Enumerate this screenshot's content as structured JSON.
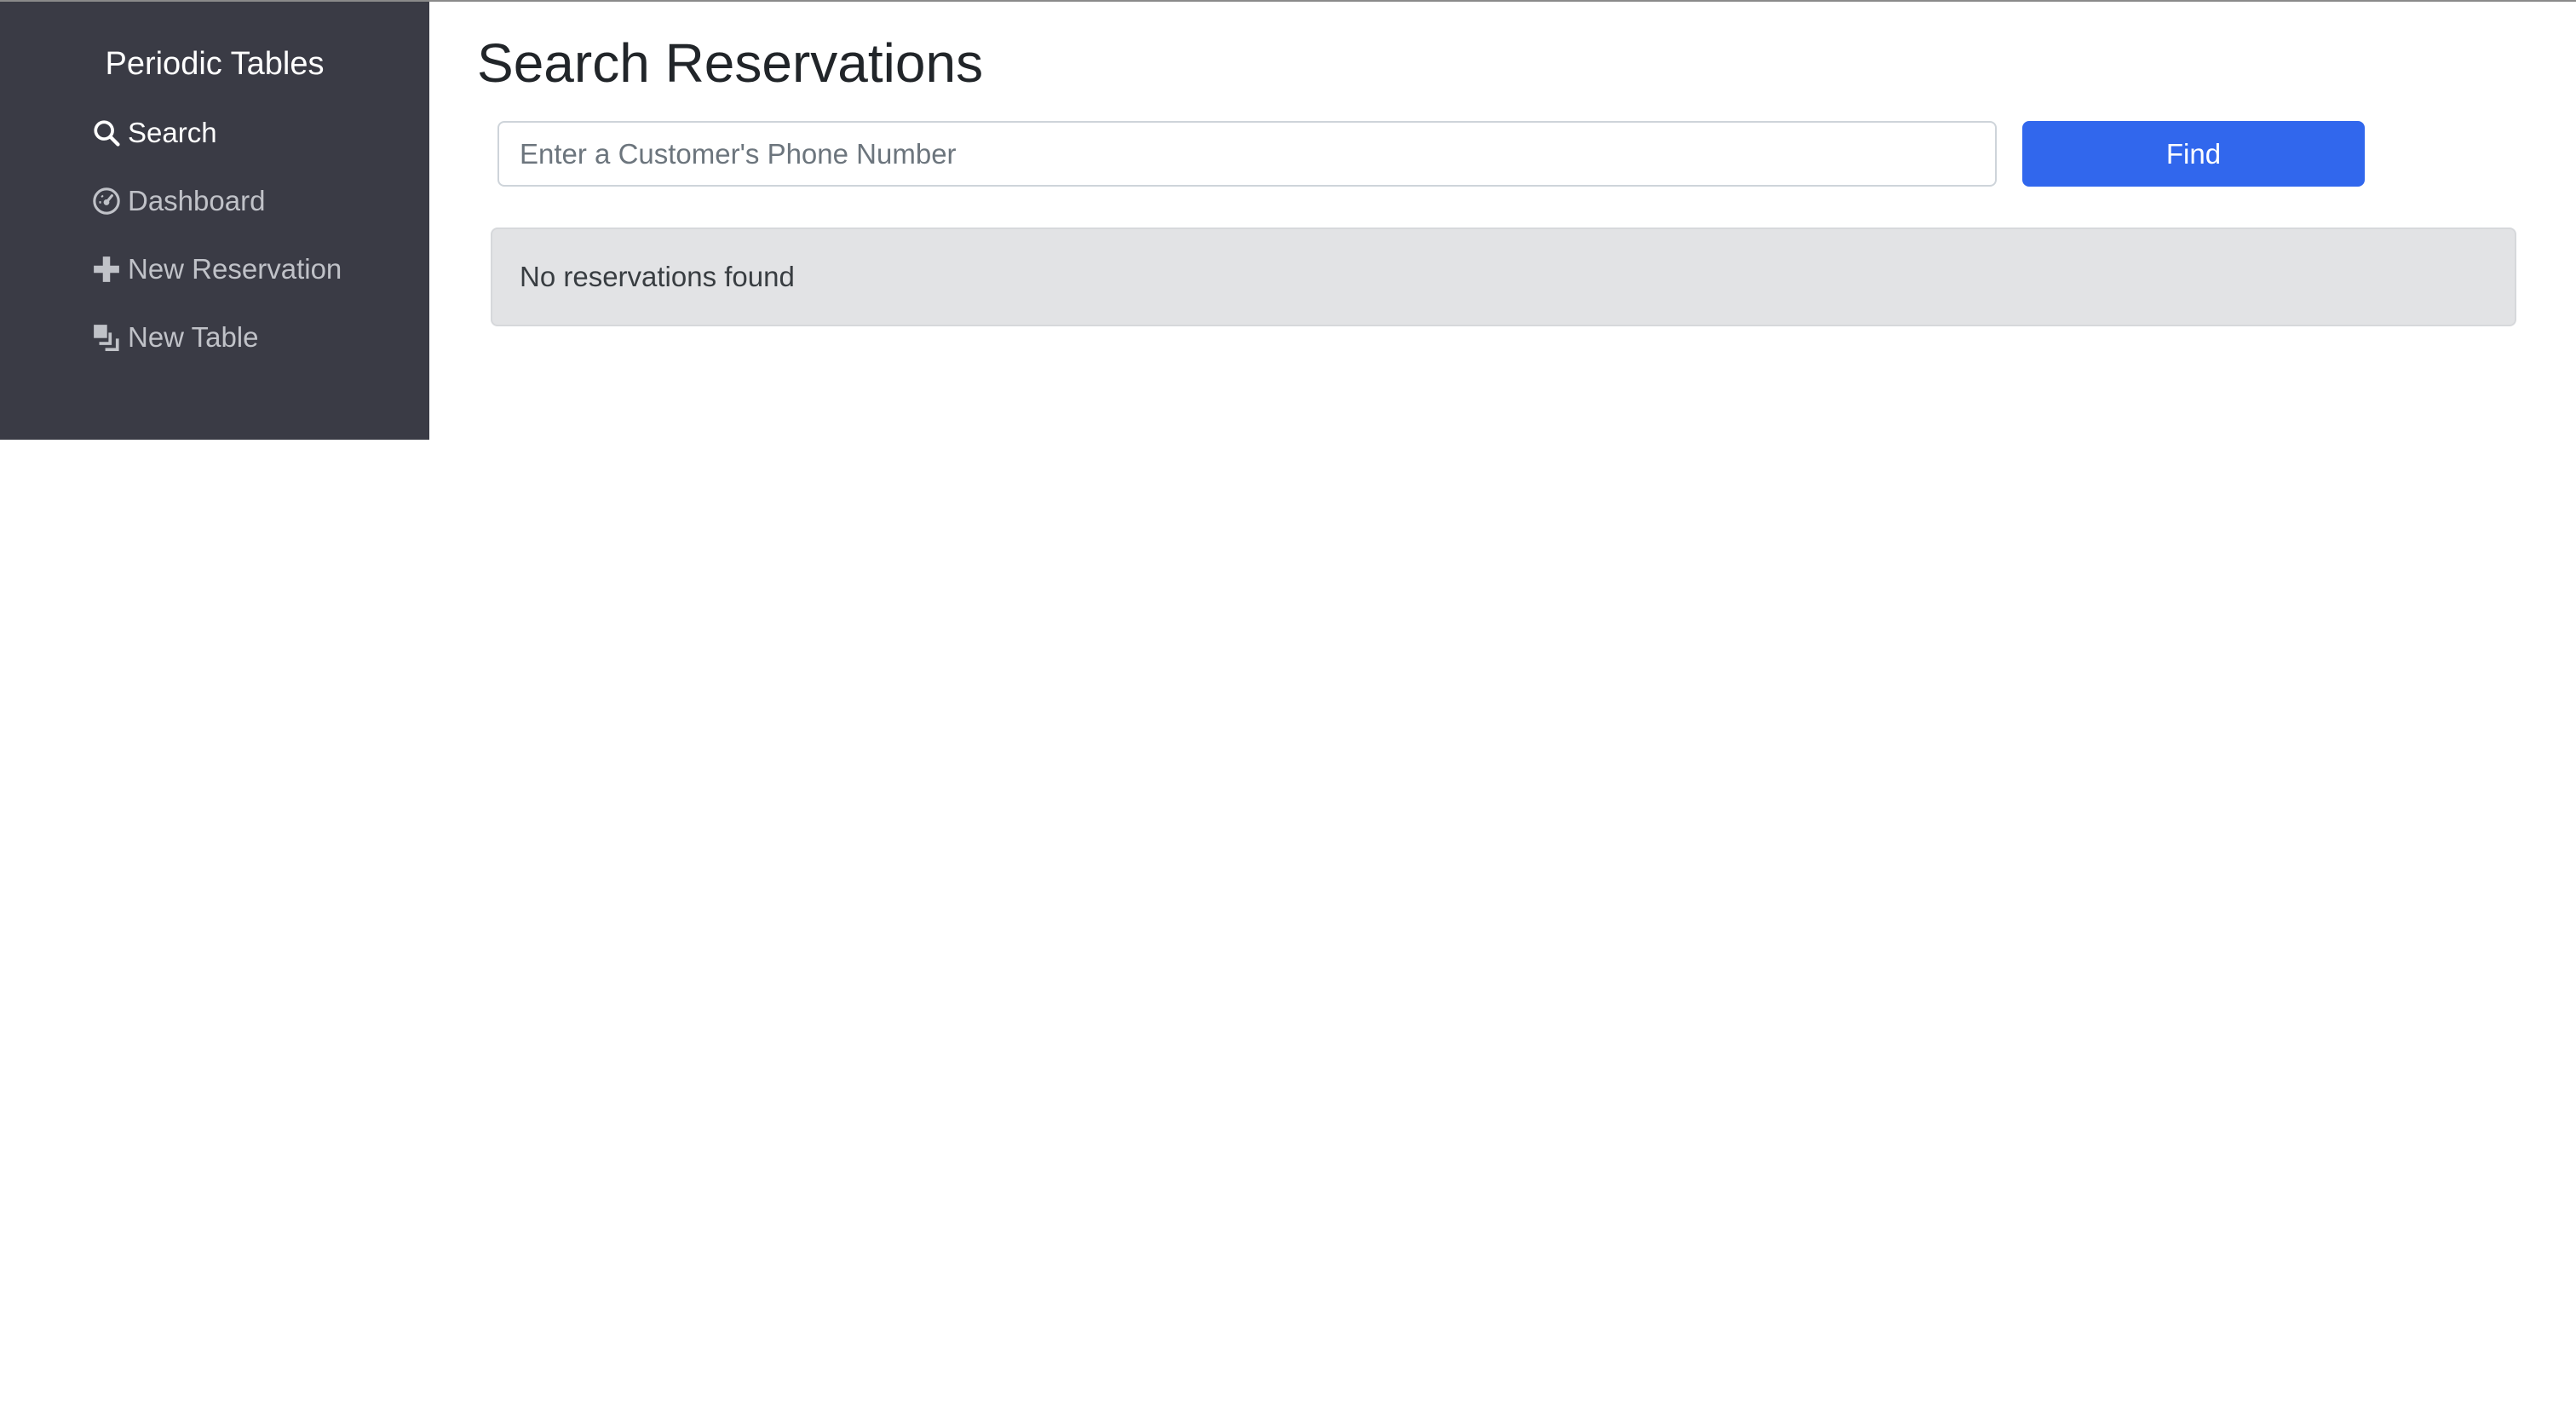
{
  "sidebar": {
    "brand": "Periodic Tables",
    "items": [
      {
        "label": "Search",
        "icon": "search-icon",
        "active": true
      },
      {
        "label": "Dashboard",
        "icon": "dashboard-icon",
        "active": false
      },
      {
        "label": "New Reservation",
        "icon": "plus-icon",
        "active": false
      },
      {
        "label": "New Table",
        "icon": "table-icon",
        "active": false
      }
    ]
  },
  "main": {
    "title": "Search Reservations",
    "search": {
      "placeholder": "Enter a Customer's Phone Number",
      "value": ""
    },
    "find_label": "Find",
    "empty_message": "No reservations found"
  },
  "colors": {
    "sidebar_bg": "#3a3b45",
    "primary": "#3167ed",
    "alert_bg": "#e2e3e5"
  }
}
